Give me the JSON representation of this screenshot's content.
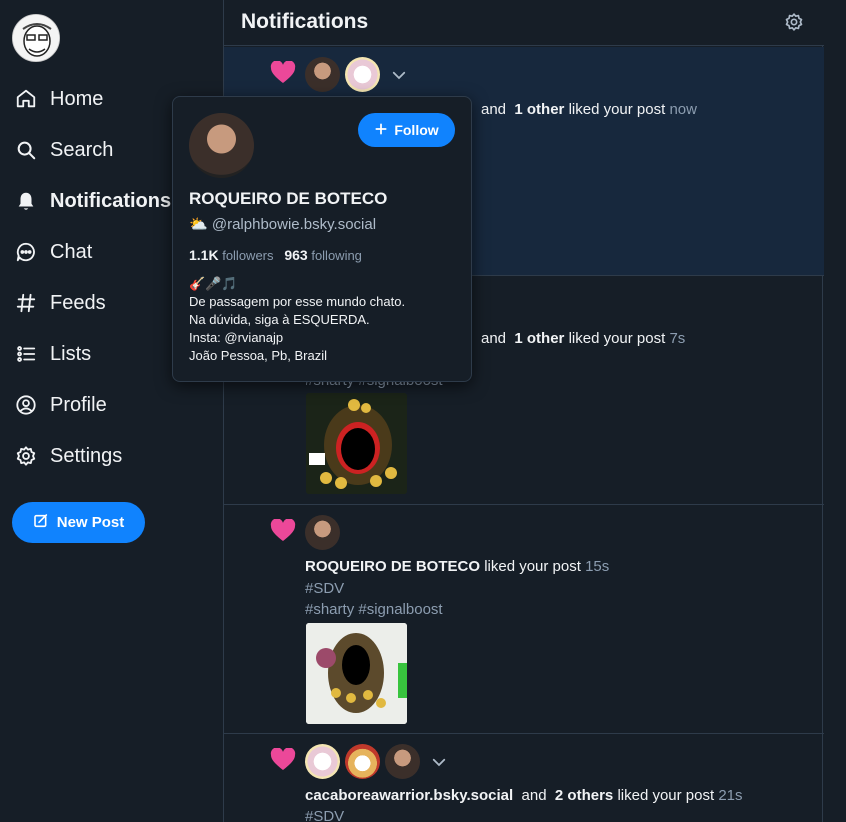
{
  "nav": {
    "items": [
      {
        "label": "Home",
        "icon": "home-icon"
      },
      {
        "label": "Search",
        "icon": "search-icon"
      },
      {
        "label": "Notifications",
        "icon": "bell-icon"
      },
      {
        "label": "Chat",
        "icon": "chat-icon"
      },
      {
        "label": "Feeds",
        "icon": "hash-icon"
      },
      {
        "label": "Lists",
        "icon": "list-icon"
      },
      {
        "label": "Profile",
        "icon": "user-circle-icon"
      },
      {
        "label": "Settings",
        "icon": "gear-icon"
      }
    ],
    "new_post_label": "New Post"
  },
  "header": {
    "title": "Notifications"
  },
  "notifications": [
    {
      "and_text": "and",
      "others": "1 other",
      "action": "liked your post",
      "time": "now"
    },
    {
      "and_text": "and",
      "others": "1 other",
      "action": "liked your post",
      "time": "7s",
      "tags": "#sharty #signalboost"
    },
    {
      "name": "ROQUEIRO DE BOTECO",
      "action": "liked your post",
      "time": "15s",
      "tag1": "#SDV",
      "tag2": "#sharty #signalboost"
    },
    {
      "name": "cacaboreawarrior.bsky.social",
      "and_text": "and",
      "others": "2 others",
      "action": "liked your post",
      "time": "21s",
      "tag1": "#SDV"
    }
  ],
  "profile_card": {
    "follow_label": "Follow",
    "name": "ROQUEIRO DE BOTECO",
    "handle_emoji": "⛅",
    "handle": "@ralphbowie.bsky.social",
    "followers_count": "1.1K",
    "followers_label": "followers",
    "following_count": "963",
    "following_label": "following",
    "bio_line1": "🎸🎤🎵",
    "bio_line2": "De passagem por esse mundo chato.",
    "bio_line3": "Na dúvida, siga à ESQUERDA.",
    "bio_line4": "Insta: @rvianajp",
    "bio_line5": "João Pessoa, Pb, Brazil"
  },
  "colors": {
    "accent": "#1083fe",
    "heart": "#ec4899",
    "background": "#161e27",
    "unread_bg": "#17283d"
  }
}
